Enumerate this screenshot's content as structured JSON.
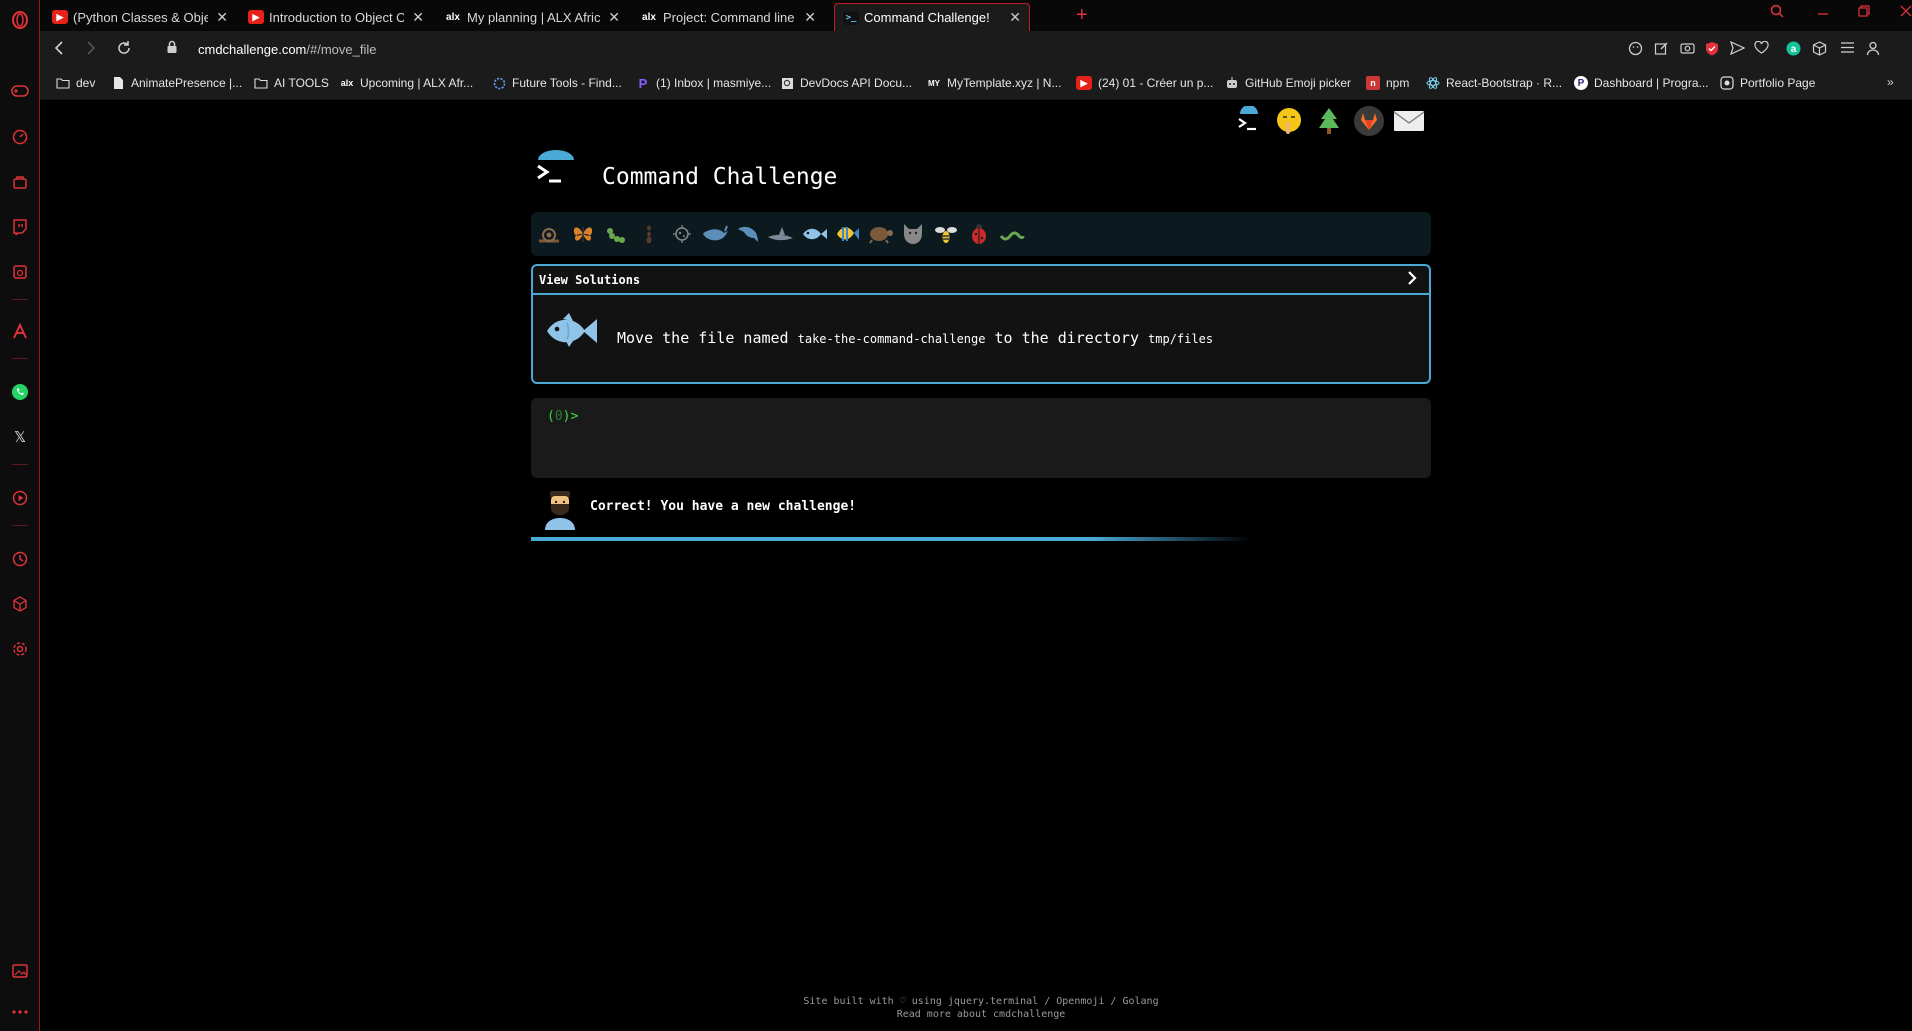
{
  "browser": {
    "tabs": [
      {
        "title": "(Python Classes & Objects)",
        "favicon": "youtube-icon",
        "active": false
      },
      {
        "title": "Introduction to Object Orie",
        "favicon": "youtube-icon",
        "active": false
      },
      {
        "title": "My planning | ALX Africa In",
        "favicon": "alx-icon",
        "active": false
      },
      {
        "title": "Project: Command line for",
        "favicon": "alx-icon",
        "active": false
      },
      {
        "title": "Command Challenge!",
        "favicon": "terminal-icon",
        "active": true
      }
    ],
    "favicon_text": {
      "alx": "alx",
      "term": ">_"
    },
    "new_tab_symbol": "+",
    "url_host": "cmdchallenge.com",
    "url_path": "/#/move_file",
    "bookmarks": [
      {
        "label": "dev",
        "icon": "folder-icon"
      },
      {
        "label": "AnimatePresence |...",
        "icon": "page-icon"
      },
      {
        "label": "AI TOOLS",
        "icon": "folder-icon"
      },
      {
        "label": "Upcoming | ALX Afr...",
        "icon": "alx-icon"
      },
      {
        "label": "Future Tools - Find...",
        "icon": "gear-icon"
      },
      {
        "label": "(1) Inbox | masmiye...",
        "icon": "p-icon"
      },
      {
        "label": "DevDocs API Docu...",
        "icon": "devdocs-icon"
      },
      {
        "label": "MyTemplate.xyz | N...",
        "icon": "my-icon"
      },
      {
        "label": "(24) 01 - Créer un p...",
        "icon": "youtube-icon"
      },
      {
        "label": "GitHub Emoji picker",
        "icon": "robot-icon"
      },
      {
        "label": "npm",
        "icon": "npm-icon"
      },
      {
        "label": "React-Bootstrap · R...",
        "icon": "react-icon"
      },
      {
        "label": "Dashboard | Progra...",
        "icon": "p-icon"
      },
      {
        "label": "Portfolio Page",
        "icon": "portfolio-icon"
      }
    ],
    "bookmark_glyphs": {
      "alx": "alx",
      "p": "P",
      "my": "MY",
      "npm": "n"
    },
    "colors": {
      "accent": "#e0323b",
      "frame": "#1b1b1b"
    }
  },
  "page": {
    "title": "Command Challenge",
    "view_solutions_label": "View Solutions",
    "challenge": {
      "text_before": "Move the file named ",
      "file_name": "take-the-command-challenge",
      "text_middle": " to the directory ",
      "directory": "tmp/files"
    },
    "prompt": {
      "open": "(",
      "count": "0",
      "close": ")>"
    },
    "feedback": "Correct! You have a new challenge!",
    "progress": 0.8,
    "footer_line1": "Site built with ♡ using jquery.terminal / Openmoji / Golang",
    "footer_line2": "Read more about cmdchallenge",
    "badges": [
      "snail-icon",
      "butterfly-icon",
      "caterpillar-icon",
      "ant-icon",
      "microbe-icon",
      "whale-icon",
      "dolphin-icon",
      "shark-icon",
      "fish-icon",
      "tropical-fish-icon",
      "turtle-icon",
      "wolf-icon",
      "bee-icon",
      "ladybug-icon",
      "worm-icon"
    ],
    "accent_color": "#4aa9d6"
  }
}
